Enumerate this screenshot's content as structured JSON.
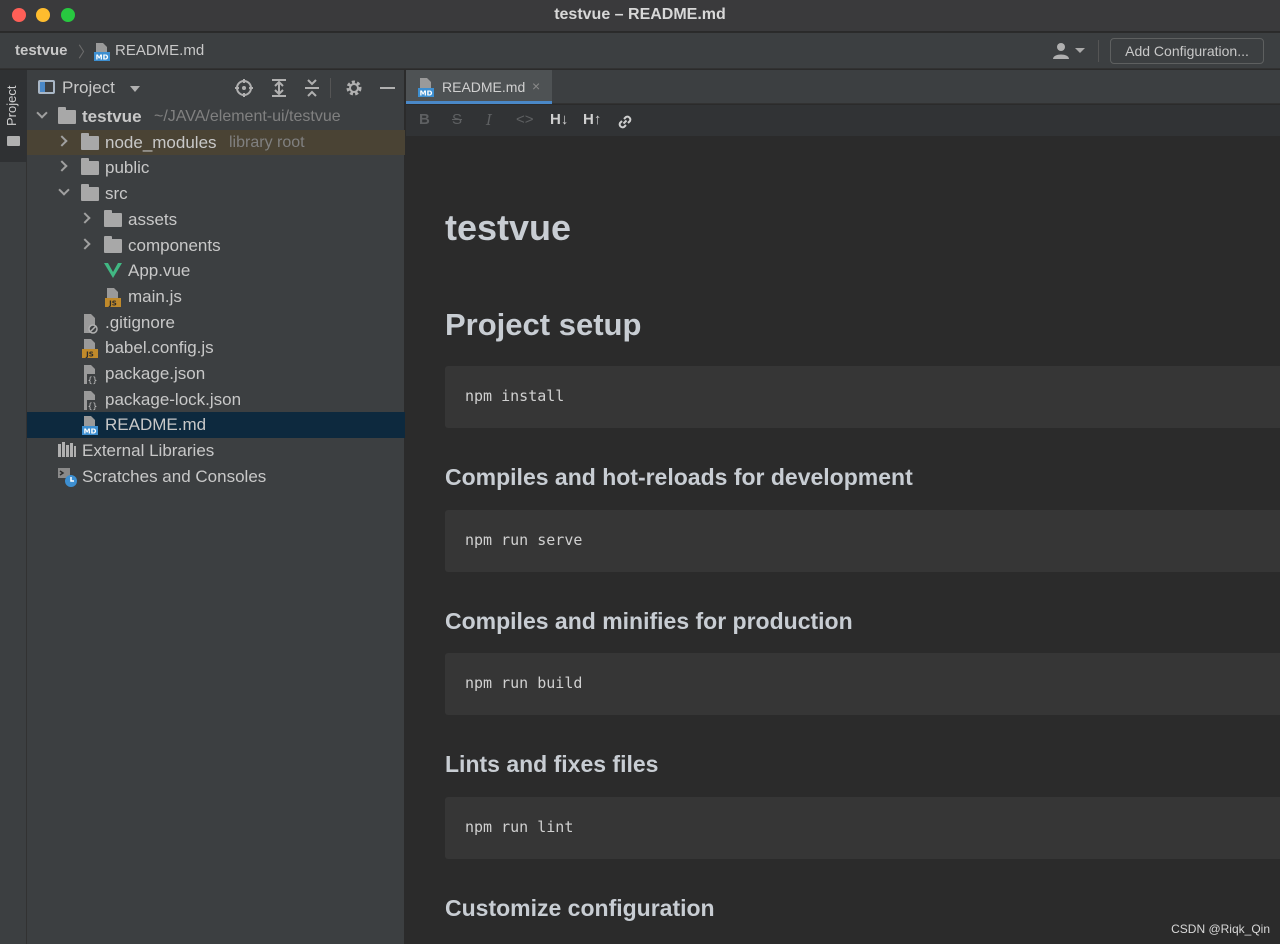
{
  "window": {
    "title": "testvue – README.md"
  },
  "navbar": {
    "project": "testvue",
    "file": "README.md",
    "add_configuration": "Add Configuration..."
  },
  "toolstrip": {
    "project_tab": "Project"
  },
  "panel": {
    "title": "Project",
    "tree": [
      {
        "label": "testvue",
        "hint": "~/JAVA/element-ui/testvue",
        "icon": "folder-icon",
        "depth": 0,
        "expanded": true
      },
      {
        "label": "node_modules",
        "hint": "library root",
        "icon": "folder-icon",
        "depth": 1,
        "expanded": false
      },
      {
        "label": "public",
        "icon": "folder-icon",
        "depth": 1,
        "expanded": false
      },
      {
        "label": "src",
        "icon": "folder-icon",
        "depth": 1,
        "expanded": true
      },
      {
        "label": "assets",
        "icon": "folder-icon",
        "depth": 2,
        "expanded": false
      },
      {
        "label": "components",
        "icon": "folder-icon",
        "depth": 2,
        "expanded": false
      },
      {
        "label": "App.vue",
        "icon": "vue-icon",
        "depth": 2
      },
      {
        "label": "main.js",
        "icon": "js-file-icon",
        "depth": 2
      },
      {
        "label": ".gitignore",
        "icon": "ignore-file-icon",
        "depth": 1
      },
      {
        "label": "babel.config.js",
        "icon": "js-file-icon",
        "depth": 1
      },
      {
        "label": "package.json",
        "icon": "json-file-icon",
        "depth": 1
      },
      {
        "label": "package-lock.json",
        "icon": "json-file-icon",
        "depth": 1
      },
      {
        "label": "README.md",
        "icon": "md-file-icon",
        "depth": 1,
        "selected": true
      },
      {
        "label": "External Libraries",
        "icon": "libraries-icon",
        "depth": 0
      },
      {
        "label": "Scratches and Consoles",
        "icon": "scratches-icon",
        "depth": 0
      }
    ]
  },
  "editor": {
    "tab": {
      "label": "README.md",
      "close": "×"
    },
    "format_toolbar": [
      "B",
      "S",
      "I",
      "<>",
      "H↓",
      "H↑",
      "link"
    ],
    "preview": {
      "h1": "testvue",
      "sections": [
        {
          "heading": "Project setup",
          "level": 2,
          "code": "npm install"
        },
        {
          "heading": "Compiles and hot-reloads for development",
          "level": 3,
          "code": "npm run serve"
        },
        {
          "heading": "Compiles and minifies for production",
          "level": 3,
          "code": "npm run build"
        },
        {
          "heading": "Lints and fixes files",
          "level": 3,
          "code": "npm run lint"
        },
        {
          "heading": "Customize configuration",
          "level": 3
        }
      ]
    }
  },
  "watermark": "CSDN @Riqk_Qin",
  "colors": {
    "selection": "#0d293e",
    "library_root": "#4a4334",
    "accent": "#4a88c7",
    "vue": "#41b883",
    "js_badge": "#c08a2b",
    "md_badge": "#3d8fd1"
  }
}
